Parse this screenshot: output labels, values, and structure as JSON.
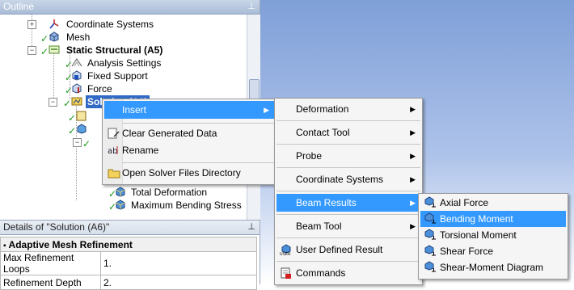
{
  "outline": {
    "title": "Outline",
    "pin": "⊥",
    "items": [
      {
        "label": "Coordinate Systems"
      },
      {
        "label": "Mesh"
      },
      {
        "label": "Static Structural (A5)"
      },
      {
        "label": "Analysis Settings"
      },
      {
        "label": "Fixed Support"
      },
      {
        "label": "Force"
      },
      {
        "label": "Solution (A6)"
      },
      {
        "label": "Total Deformation"
      },
      {
        "label": "Maximum Bending Stress"
      }
    ]
  },
  "details": {
    "title": "Details of \"Solution (A6)\"",
    "pin": "⊥",
    "group": "Adaptive Mesh Refinement",
    "rows": [
      {
        "name": "Max Refinement Loops",
        "value": "1."
      },
      {
        "name": "Refinement Depth",
        "value": "2."
      }
    ]
  },
  "context_menu": {
    "insert": "Insert",
    "clear": "Clear Generated Data",
    "rename": "Rename",
    "open_solver": "Open Solver Files Directory"
  },
  "insert_menu": {
    "items": [
      "Deformation",
      "Contact Tool",
      "Probe",
      "Coordinate Systems",
      "Beam Results",
      "Beam Tool",
      "User Defined Result",
      "Commands"
    ]
  },
  "beam_menu": {
    "items": [
      "Axial Force",
      "Bending Moment",
      "Torsional Moment",
      "Shear Force",
      "Shear-Moment Diagram"
    ]
  },
  "colors": {
    "highlight": "#3399ff",
    "check": "#1f9a1f"
  }
}
